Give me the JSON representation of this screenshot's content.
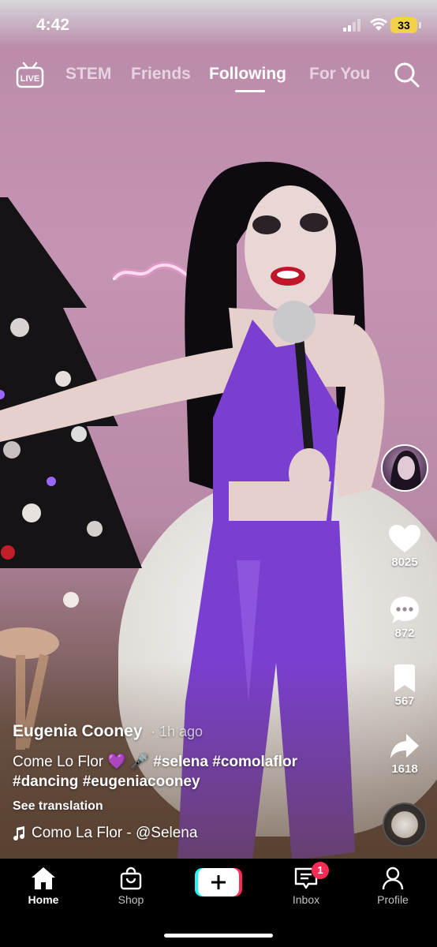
{
  "status_bar": {
    "time": "4:42",
    "battery": "33"
  },
  "top_nav": {
    "tabs": [
      {
        "label": "STEM",
        "active": false
      },
      {
        "label": "Friends",
        "active": false
      },
      {
        "label": "Following",
        "active": true
      },
      {
        "label": "For You",
        "active": false
      }
    ],
    "live_label": "LIVE"
  },
  "video": {
    "author": "Eugenia Cooney",
    "time_ago": "· 1h ago",
    "description_text": "Come Lo Flor 💜 🎤",
    "hashtags": [
      "#selena",
      "#comolaflor",
      "#dancing",
      "#eugeniacooney"
    ],
    "see_translation": "See translation",
    "music": "Como La Flor - @Selena"
  },
  "actions": {
    "likes": "8025",
    "comments": "872",
    "saves": "567",
    "shares": "1618"
  },
  "bottom_nav": {
    "items": [
      {
        "label": "Home",
        "active": true
      },
      {
        "label": "Shop",
        "active": false
      },
      {
        "label": "Inbox",
        "active": false,
        "badge": "1"
      },
      {
        "label": "Profile",
        "active": false
      }
    ]
  },
  "colors": {
    "accent": "#fe2c55",
    "accent_alt": "#25f4ee",
    "outfit": "#7a3fd0"
  }
}
